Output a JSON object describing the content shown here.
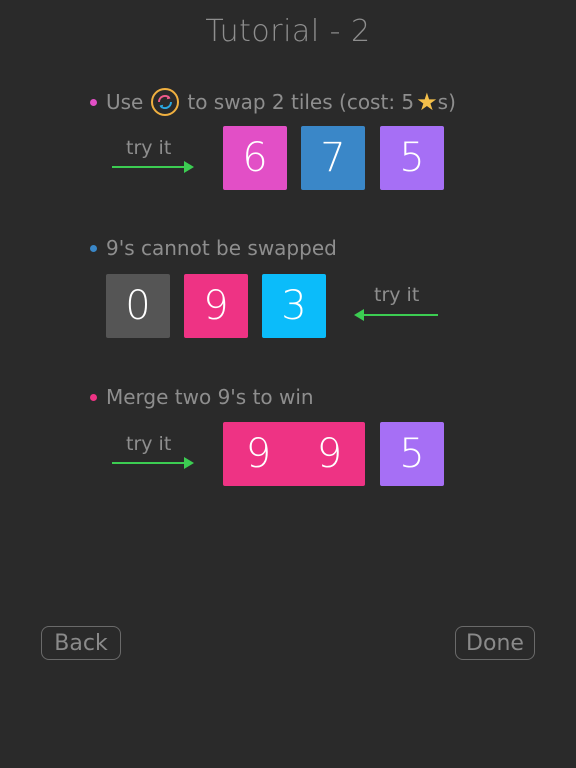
{
  "title": "Tutorial - 2",
  "colors": {
    "pink": "#e24fc6",
    "blue": "#3a87c8",
    "purple": "#a66ff5",
    "gray": "#555555",
    "red": "#ee3384",
    "cyan": "#0bbcfa",
    "arrow": "#3ccd52",
    "star": "#f5c04a"
  },
  "section1": {
    "prefix": "Use",
    "suffix": "to swap 2 tiles (cost: 5",
    "end": "s)",
    "icon": "swap-icon",
    "try_label": "try it",
    "tiles": [
      "6",
      "7",
      "5"
    ]
  },
  "section2": {
    "text": "9's cannot be swapped",
    "try_label": "try it",
    "tiles": [
      "0",
      "9",
      "3"
    ]
  },
  "section3": {
    "text": "Merge two 9's to win",
    "try_label": "try it",
    "merged_left": "9",
    "merged_right": "9",
    "tile": "5"
  },
  "buttons": {
    "back": "Back",
    "done": "Done"
  }
}
